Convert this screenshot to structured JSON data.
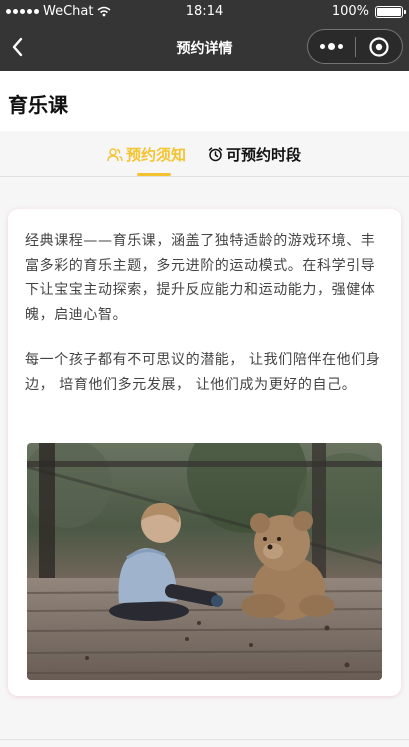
{
  "status_bar": {
    "carrier": "WeChat",
    "time": "18:14",
    "battery": "100%"
  },
  "nav": {
    "title": "预约详情"
  },
  "page": {
    "title": "育乐课"
  },
  "tabs": [
    {
      "label": "预约须知",
      "icon": "users-icon",
      "active": true
    },
    {
      "label": "可预约时段",
      "icon": "alarm-clock-icon",
      "active": false
    }
  ],
  "content": {
    "paragraph1": "经典课程——育乐课，涵盖了独特适龄的游戏环境、丰富多彩的育乐主题，多元进阶的运动模式。在科学引导下让宝宝主动探索，提升反应能力和运动能力，强健体魄，启迪心智。",
    "paragraph2": "每一个孩子都有不可思议的潜能， 让我们陪伴在他们身边， 培育他们多元发展， 让他们成为更好的自己。"
  },
  "colors": {
    "accent": "#f4c430",
    "navbar": "#353535"
  }
}
